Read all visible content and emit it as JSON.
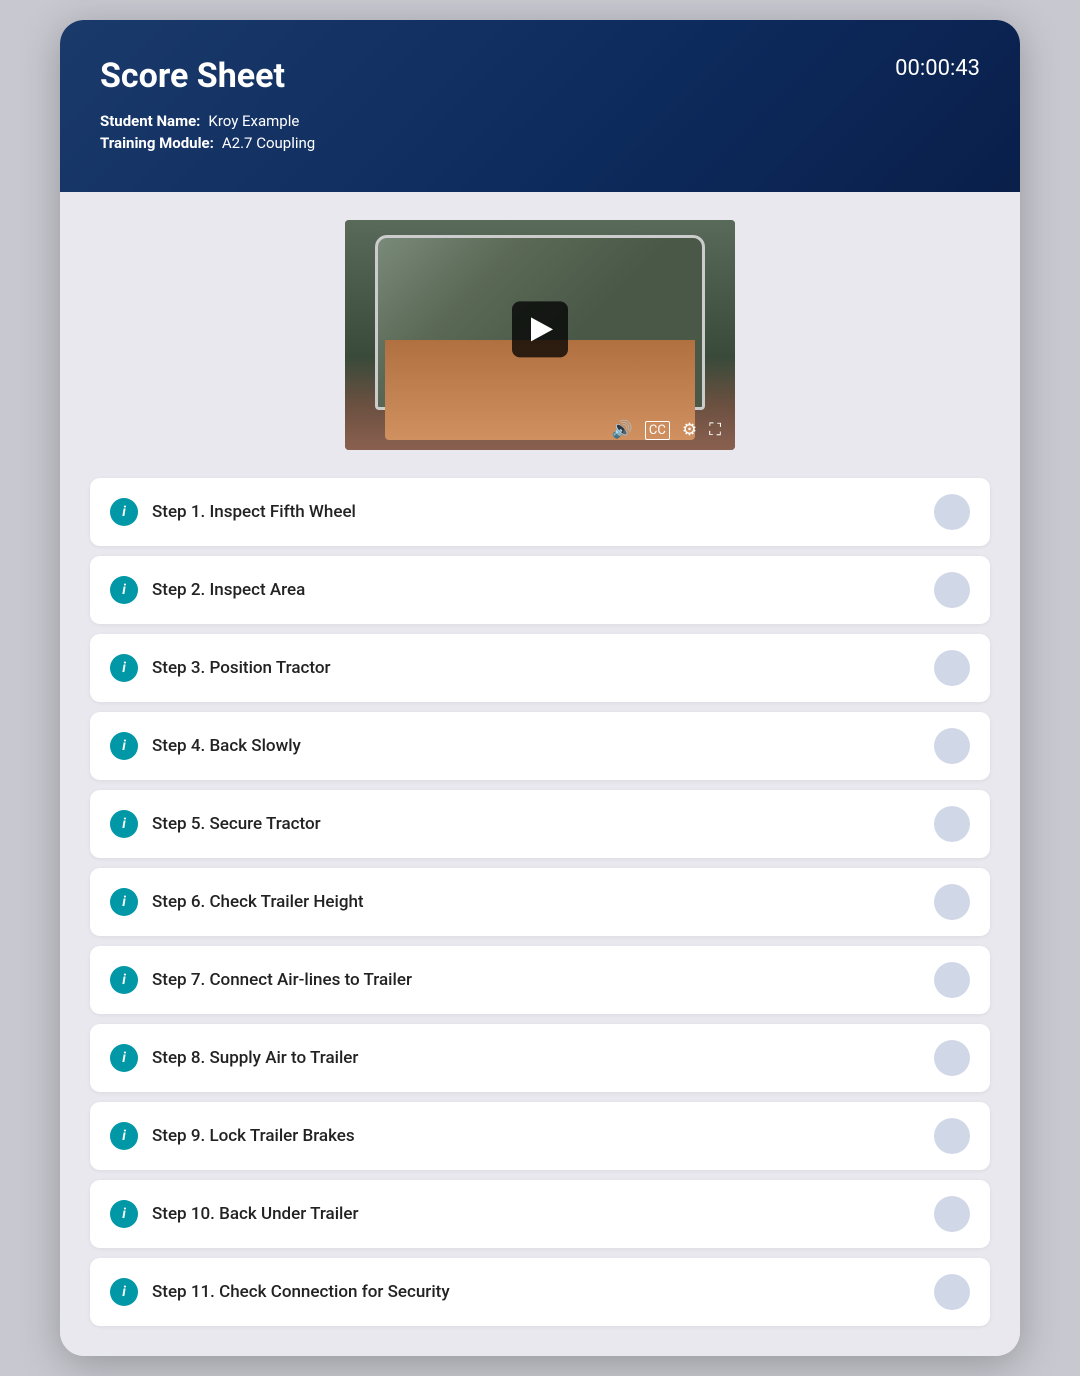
{
  "header": {
    "title": "Score Sheet",
    "timer": "00:00:43",
    "student_label": "Student Name:",
    "student_value": "Kroy Example",
    "module_label": "Training Module:",
    "module_value": "A2.7 Coupling"
  },
  "video": {
    "controls": [
      "🔊",
      "CC",
      "⚙",
      "⛶"
    ]
  },
  "steps": [
    {
      "id": 1,
      "label": "Step 1. Inspect Fifth Wheel"
    },
    {
      "id": 2,
      "label": "Step 2. Inspect Area"
    },
    {
      "id": 3,
      "label": "Step 3. Position Tractor"
    },
    {
      "id": 4,
      "label": "Step 4. Back Slowly"
    },
    {
      "id": 5,
      "label": "Step 5. Secure Tractor"
    },
    {
      "id": 6,
      "label": "Step 6. Check Trailer Height"
    },
    {
      "id": 7,
      "label": "Step 7. Connect Air-lines to Trailer"
    },
    {
      "id": 8,
      "label": "Step 8. Supply Air to Trailer"
    },
    {
      "id": 9,
      "label": "Step 9. Lock Trailer Brakes"
    },
    {
      "id": 10,
      "label": "Step 10. Back Under Trailer"
    },
    {
      "id": 11,
      "label": "Step 11. Check Connection for Security"
    }
  ]
}
